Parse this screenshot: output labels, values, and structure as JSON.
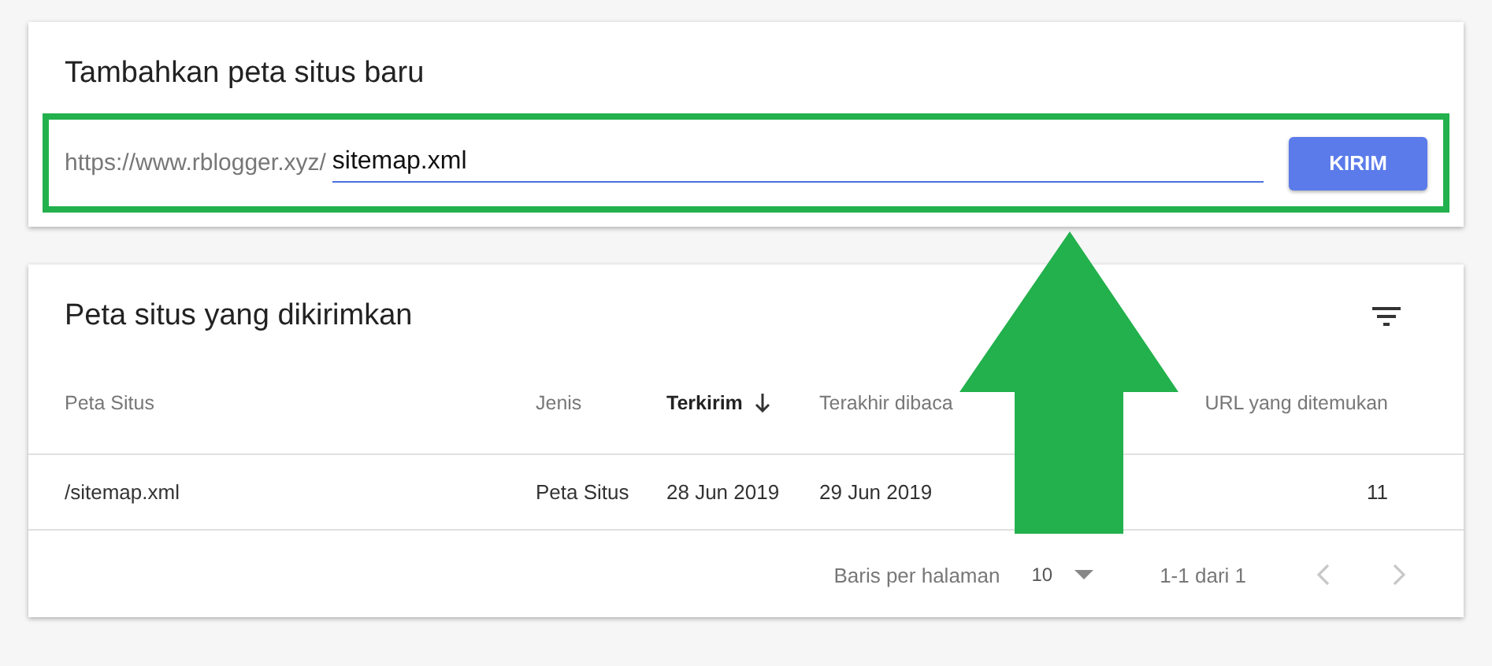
{
  "add_card": {
    "title": "Tambahkan peta situs baru",
    "url_prefix": "https://www.rblogger.xyz/",
    "input_value": "sitemap.xml",
    "submit_label": "KIRIM",
    "highlighted": true
  },
  "list_card": {
    "title": "Peta situs yang dikirimkan",
    "columns": [
      {
        "label": "Peta Situs",
        "sorted": false
      },
      {
        "label": "Jenis",
        "sorted": false
      },
      {
        "label": "Terkirim",
        "sorted": true
      },
      {
        "label": "Terakhir dibaca",
        "sorted": false
      },
      {
        "label": "URL yang ditemukan",
        "sorted": false
      }
    ],
    "rows": [
      {
        "cells": [
          "/sitemap.xml",
          "Peta Situs",
          "28 Jun 2019",
          "29 Jun 2019",
          "11"
        ]
      }
    ],
    "pagination": {
      "rows_label": "Baris per halaman",
      "rows_value": "10",
      "range": "1-1 dari 1",
      "prev_disabled": true,
      "next_disabled": true
    }
  },
  "annotation": {
    "arrow": true
  }
}
